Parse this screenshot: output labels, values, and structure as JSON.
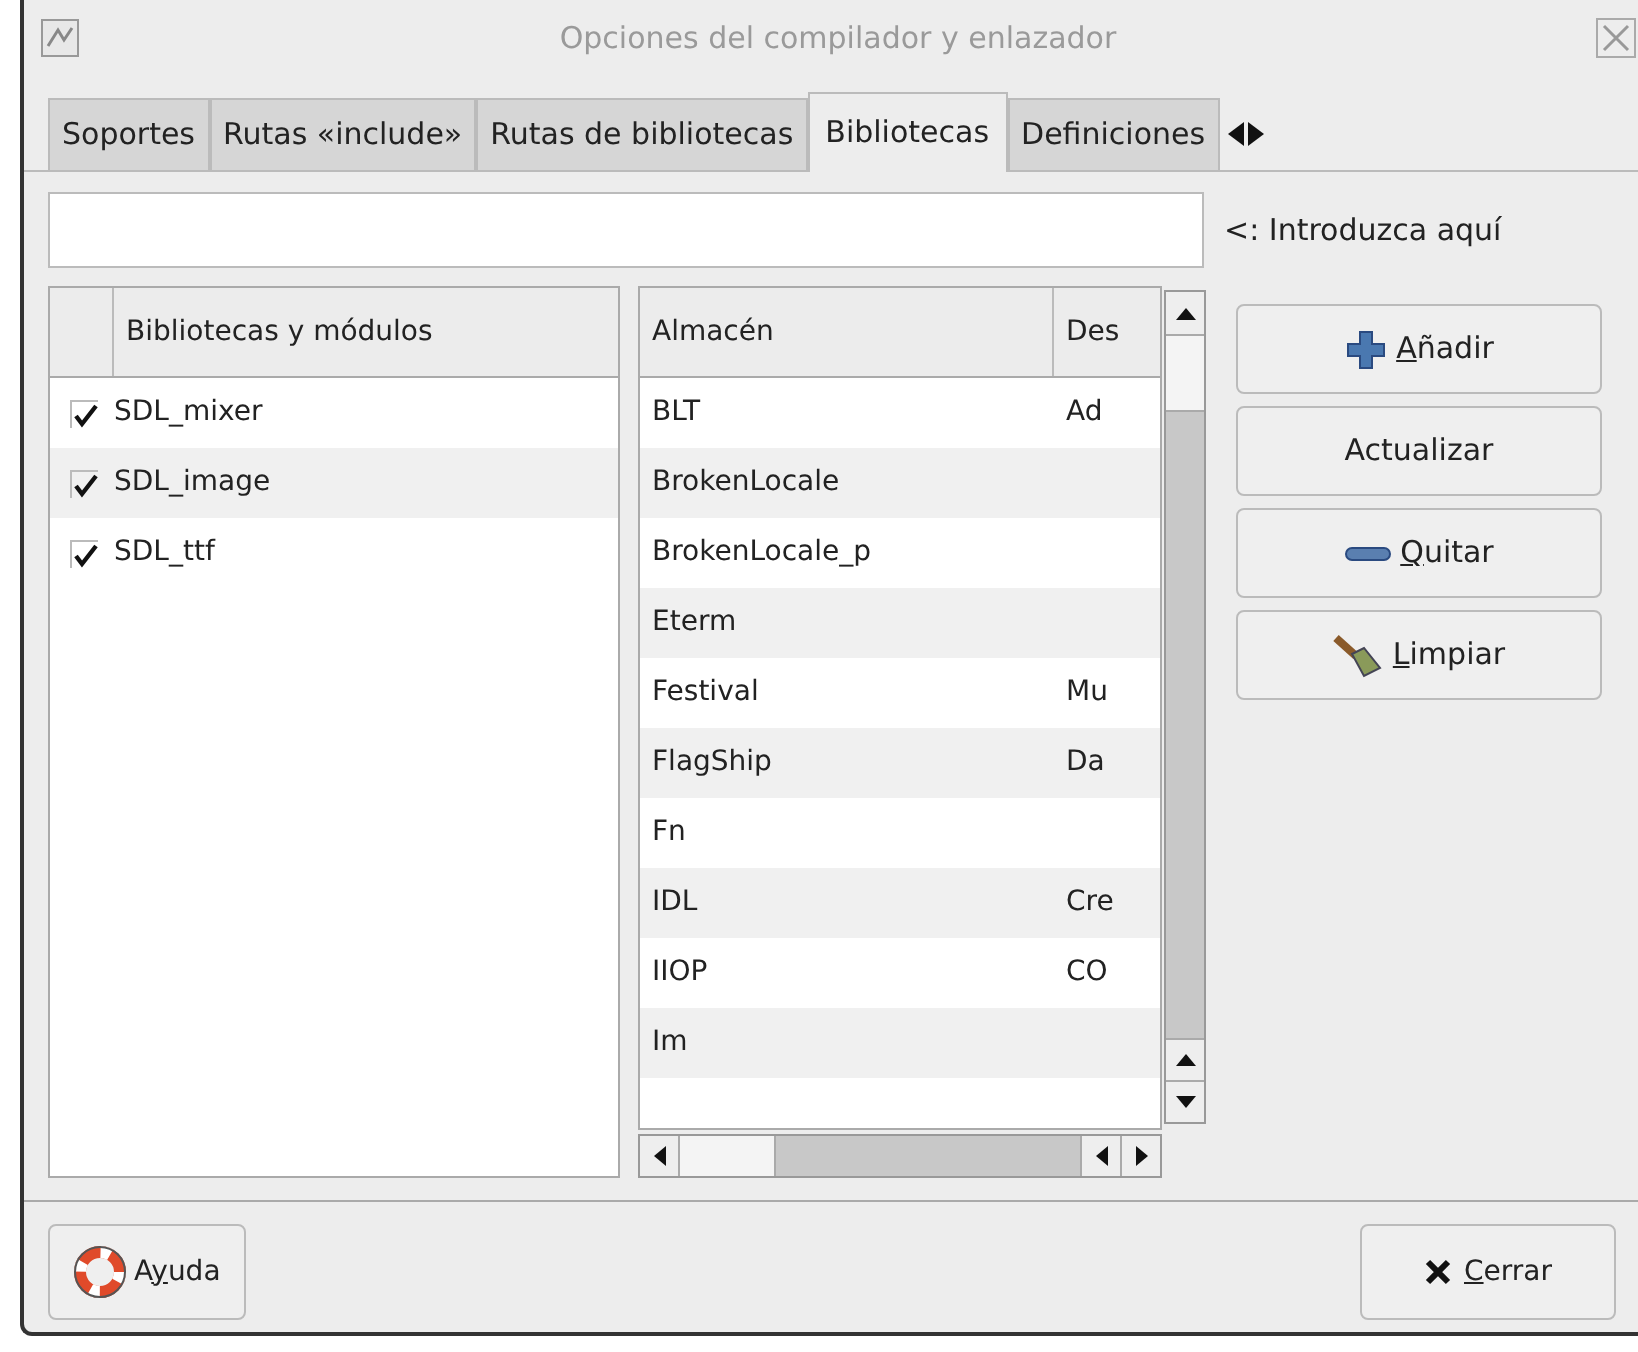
{
  "window": {
    "title": "Opciones del compilador y enlazador"
  },
  "tabs": [
    {
      "label": "Soportes",
      "selected": false
    },
    {
      "label": "Rutas «include»",
      "selected": false
    },
    {
      "label": "Rutas de bibliotecas",
      "selected": false
    },
    {
      "label": "Bibliotecas",
      "selected": true
    },
    {
      "label": "Definiciones",
      "selected": false
    }
  ],
  "entry": {
    "hint_label": "<: Introduzca aquí"
  },
  "modules": {
    "column": "Bibliotecas y módulos",
    "rows": [
      {
        "name": "SDL_mixer",
        "checked": true
      },
      {
        "name": "SDL_image",
        "checked": true
      },
      {
        "name": "SDL_ttf",
        "checked": true
      }
    ]
  },
  "store": {
    "columns": [
      "Almacén",
      "Des"
    ],
    "rows": [
      [
        "BLT",
        "Ad"
      ],
      [
        "BrokenLocale"
      ],
      [
        "BrokenLocale_p"
      ],
      [
        "Eterm"
      ],
      [
        "Festival",
        "Mu"
      ],
      [
        "FlagShip",
        "Da"
      ],
      [
        "Fn"
      ],
      [
        "IDL",
        "Cre"
      ],
      [
        "IIOP",
        "CO"
      ],
      [
        "Im"
      ]
    ]
  },
  "side_buttons": [
    {
      "kind": "add",
      "key": "A",
      "post": "ñadir"
    },
    {
      "kind": "plain",
      "pre": "Actualizar"
    },
    {
      "kind": "remove",
      "key": "Q",
      "post": "uitar"
    },
    {
      "kind": "clear",
      "key": "L",
      "post": "impiar"
    }
  ],
  "footer": {
    "help": {
      "pre": "A",
      "key": "y",
      "post": "uda"
    },
    "close": {
      "key": "C",
      "post": "errar"
    }
  }
}
